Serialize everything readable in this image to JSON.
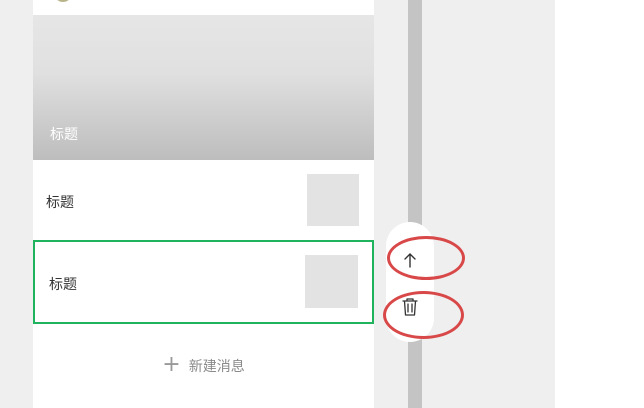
{
  "cover": {
    "title": "标题"
  },
  "list_items": [
    {
      "title": "标题"
    },
    {
      "title": "标题"
    }
  ],
  "new_message": {
    "label": "新建消息",
    "icon": "plus-icon"
  },
  "actions": {
    "move_up_icon": "arrow-up-icon",
    "delete_icon": "trash-icon"
  },
  "colors": {
    "selected_border": "#1fb35e",
    "annotation_ring": "#d94848"
  }
}
